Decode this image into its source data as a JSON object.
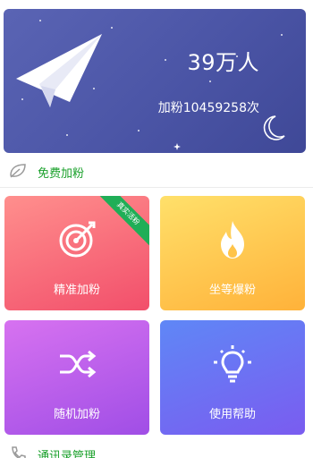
{
  "hero": {
    "count": "39万人",
    "total": "加粉10459258次"
  },
  "sections": {
    "free_fans": "免费加粉",
    "contacts": "通讯录管理"
  },
  "tiles": [
    {
      "label": "精准加粉",
      "icon": "target-arrow-icon",
      "badge": "真实活粉"
    },
    {
      "label": "坐等爆粉",
      "icon": "flame-icon"
    },
    {
      "label": "随机加粉",
      "icon": "shuffle-icon"
    },
    {
      "label": "使用帮助",
      "icon": "lightbulb-icon"
    }
  ],
  "colors": {
    "hero_bg": "#4b55a6",
    "section_text": "#19a02a",
    "tile1": "#f24f6b",
    "tile2": "#ffb23a",
    "tile3": "#a04ee6",
    "tile4": "#6b6ef3",
    "ribbon": "#1fae57"
  }
}
